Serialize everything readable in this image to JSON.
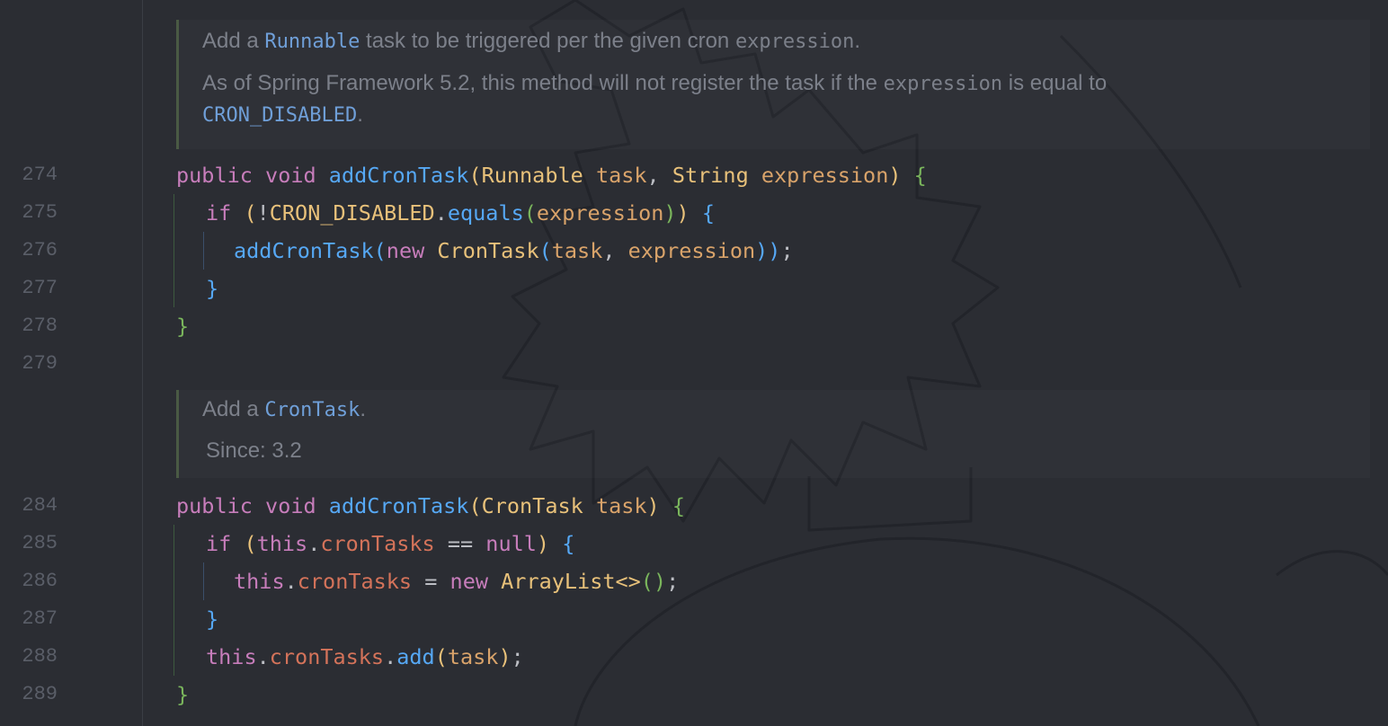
{
  "gutter": {
    "line_numbers": {
      "l274": "274",
      "l275": "275",
      "l276": "276",
      "l277": "277",
      "l278": "278",
      "l279": "279",
      "l284": "284",
      "l285": "285",
      "l286": "286",
      "l287": "287",
      "l288": "288",
      "l289": "289"
    }
  },
  "doc1": {
    "line1": {
      "pre": "Add a ",
      "code": "Runnable",
      "mid": " task to be triggered per the given cron ",
      "code2": "expression",
      "post": "."
    },
    "line2": {
      "pre": "As of Spring Framework 5.2, this method will not register the task if the ",
      "code": "expression",
      "post": " is equal to"
    },
    "line3": {
      "code": "CRON_DISABLED",
      "post": "."
    }
  },
  "doc2": {
    "line1": {
      "pre": "Add a ",
      "code": "CronTask",
      "post": "."
    },
    "line2": {
      "text": "Since: 3.2"
    }
  },
  "tokens": {
    "public": "public",
    "void": "void",
    "if": "if",
    "new": "new",
    "this": "this",
    "null": "null",
    "addCronTask": "addCronTask",
    "Runnable": "Runnable",
    "String": "String",
    "CronTask": "CronTask",
    "ArrayList": "ArrayList",
    "task": "task",
    "expression": "expression",
    "CRON_DISABLED": "CRON_DISABLED",
    "equals": "equals",
    "cronTasks": "cronTasks",
    "add": "add",
    "lparen": "(",
    "rparen": ")",
    "lbrace": "{",
    "rbrace": "}",
    "comma": ", ",
    "dot": ".",
    "semicolon": ";",
    "bang": "!",
    "eqeq": " == ",
    "assign": " = ",
    "diamond": "<>"
  }
}
